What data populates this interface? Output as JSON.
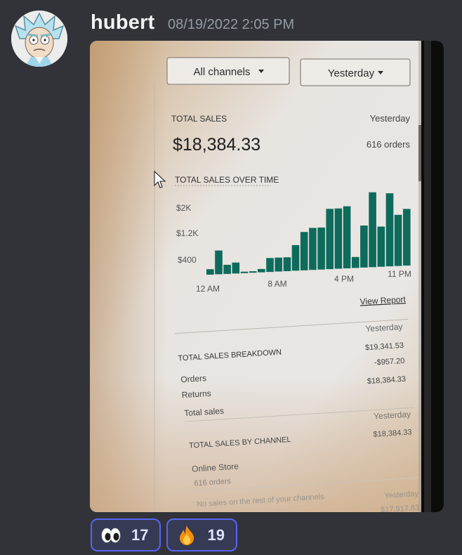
{
  "message": {
    "author": "hubert",
    "timestamp": "08/19/2022 2:05 PM",
    "avatar_icon": "rick-portrait-avatar",
    "attachment": {
      "kind": "photo-of-monitor",
      "dropdowns": [
        "All channels",
        "Yesterday"
      ],
      "total_sales_label": "TOTAL SALES",
      "total_sales_period": "Yesterday",
      "total_sales_value": "$18,384.33",
      "orders_count": "616 orders",
      "chart_title": "TOTAL SALES OVER TIME",
      "y_ticks": [
        "$2K",
        "$1.2K",
        "$400"
      ],
      "x_ticks": [
        "12 AM",
        "8 AM",
        "4 PM",
        "11 PM"
      ],
      "view_report": "View Report",
      "breakdown": {
        "title": "TOTAL SALES BREAKDOWN",
        "period": "Yesterday",
        "rows": [
          {
            "label": "Orders",
            "value": "$19,341.53"
          },
          {
            "label": "Returns",
            "value": "-$957.20"
          },
          {
            "label": "Total sales",
            "value": "$18,384.33"
          }
        ]
      },
      "by_channel": {
        "title": "TOTAL SALES BY CHANNEL",
        "period": "Yesterday",
        "channel": "Online Store",
        "channel_value": "$18,384.33",
        "channel_orders": "616 orders",
        "note": "No sales on the rest of your channels",
        "footer_period": "Yesterday",
        "footer_value": "$17,917.83"
      }
    }
  },
  "chart_data": {
    "type": "bar",
    "title": "TOTAL SALES OVER TIME",
    "categories": [
      "12 AM",
      "1 AM",
      "2 AM",
      "3 AM",
      "4 AM",
      "5 AM",
      "6 AM",
      "7 AM",
      "8 AM",
      "9 AM",
      "10 AM",
      "11 AM",
      "12 PM",
      "1 PM",
      "2 PM",
      "3 PM",
      "4 PM",
      "5 PM",
      "6 PM",
      "7 PM",
      "8 PM",
      "9 PM",
      "10 PM",
      "11 PM"
    ],
    "values": [
      150,
      650,
      250,
      300,
      40,
      40,
      90,
      380,
      380,
      380,
      700,
      1050,
      1150,
      1150,
      1650,
      1650,
      1700,
      300,
      1150,
      2050,
      1100,
      2000,
      1400,
      1550
    ],
    "y_ticks": [
      "$2K",
      "$1.2K",
      "$400"
    ],
    "x_ticks": [
      "12 AM",
      "8 AM",
      "4 PM",
      "11 PM"
    ],
    "bar_color": "#0e6b5c"
  },
  "reactions": [
    {
      "emoji": "eyes-emoji",
      "count": "17"
    },
    {
      "emoji": "fire-emoji",
      "count": "19"
    }
  ],
  "colors": {
    "background": "#313338",
    "username": "#f2f3f5",
    "timestamp": "#949ba4",
    "reaction_border": "#5865f2",
    "reaction_bg": "#373a54"
  }
}
